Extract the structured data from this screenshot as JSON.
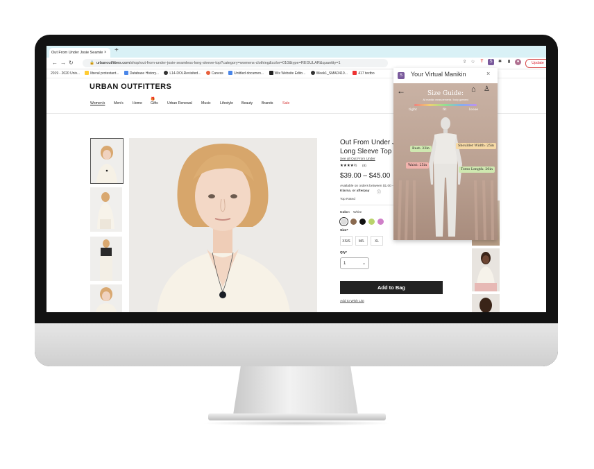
{
  "browser": {
    "tab_title": "Out From Under Josie Seamle",
    "tab_close": "×",
    "new_tab": "+",
    "back": "←",
    "forward": "→",
    "reload": "↻",
    "url_domain": "urbanoutfitters.com",
    "url_path": "/shop/out-from-under-josie-seamless-long-sleeve-top?category=womens-clothing&color=010&type=REGULAR&quantity=1",
    "update_label": "Update",
    "bookmarks": [
      "2019 - 2020 Univ...",
      "liberal protestant...",
      "Database History...",
      "L14-DOLRevisited...",
      "Canvas",
      "Untitled documen...",
      "Wix Website Edito...",
      "Week1_SMAD410...",
      "417 textbo"
    ]
  },
  "site": {
    "logo": "URBAN OUTFITTERS",
    "nav": [
      "Women's",
      "Men's",
      "Home",
      "Gifts",
      "Urban Renewal",
      "Music",
      "Lifestyle",
      "Beauty",
      "Brands",
      "Sale"
    ],
    "product": {
      "title_line1": "Out From Under Jo",
      "title_line2": "Long Sleeve Top",
      "see_all": "See all Out From Under",
      "rating_stars": "★★★★½",
      "rating_count": "(8)",
      "price": "$39.00 – $45.00",
      "installments": "Available on orders between $1.00 -",
      "klarna": "Klarna. or afterpay",
      "top_rated": "Top Rated",
      "color_label": "Color:",
      "color_value": "White",
      "swatches": [
        "#dcdcdc",
        "#8a6a50",
        "#111111",
        "#b9d36b",
        "#cf7fc8"
      ],
      "size_label": "Size*",
      "sizes": [
        "XS/S",
        "M/L",
        "XL"
      ],
      "qty_label": "Qty*",
      "qty_value": "1",
      "add_to_bag": "Add to Bag",
      "wishlist": "Add to Wish List"
    }
  },
  "extension": {
    "title": "Your Virtual Manikin",
    "close": "×",
    "size_guide": "Size Guide:",
    "size_guide_sub": "All manikin measurements / body garment",
    "fit_scale": [
      "tight",
      "fit",
      "loose"
    ],
    "measurements": {
      "bust": "Bust: 33in",
      "shoulder": "Shoulder Width: 25in",
      "waist": "Waist: 25in",
      "torso": "Torso Length: 20in"
    }
  },
  "colors": {
    "accent_sale": "#d63b3b",
    "button_dark": "#222222",
    "tab_bar": "#d9f1f6",
    "extension_brand": "#7a5a9c"
  }
}
